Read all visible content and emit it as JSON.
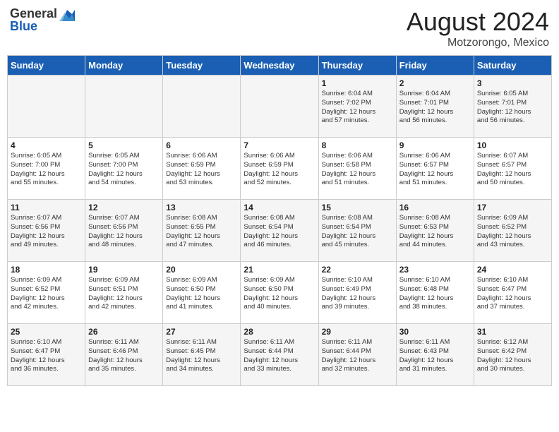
{
  "logo": {
    "general": "General",
    "blue": "Blue"
  },
  "title": "August 2024",
  "subtitle": "Motzorongo, Mexico",
  "days_of_week": [
    "Sunday",
    "Monday",
    "Tuesday",
    "Wednesday",
    "Thursday",
    "Friday",
    "Saturday"
  ],
  "weeks": [
    [
      {
        "day": "",
        "content": ""
      },
      {
        "day": "",
        "content": ""
      },
      {
        "day": "",
        "content": ""
      },
      {
        "day": "",
        "content": ""
      },
      {
        "day": "1",
        "content": "Sunrise: 6:04 AM\nSunset: 7:02 PM\nDaylight: 12 hours\nand 57 minutes."
      },
      {
        "day": "2",
        "content": "Sunrise: 6:04 AM\nSunset: 7:01 PM\nDaylight: 12 hours\nand 56 minutes."
      },
      {
        "day": "3",
        "content": "Sunrise: 6:05 AM\nSunset: 7:01 PM\nDaylight: 12 hours\nand 56 minutes."
      }
    ],
    [
      {
        "day": "4",
        "content": "Sunrise: 6:05 AM\nSunset: 7:00 PM\nDaylight: 12 hours\nand 55 minutes."
      },
      {
        "day": "5",
        "content": "Sunrise: 6:05 AM\nSunset: 7:00 PM\nDaylight: 12 hours\nand 54 minutes."
      },
      {
        "day": "6",
        "content": "Sunrise: 6:06 AM\nSunset: 6:59 PM\nDaylight: 12 hours\nand 53 minutes."
      },
      {
        "day": "7",
        "content": "Sunrise: 6:06 AM\nSunset: 6:59 PM\nDaylight: 12 hours\nand 52 minutes."
      },
      {
        "day": "8",
        "content": "Sunrise: 6:06 AM\nSunset: 6:58 PM\nDaylight: 12 hours\nand 51 minutes."
      },
      {
        "day": "9",
        "content": "Sunrise: 6:06 AM\nSunset: 6:57 PM\nDaylight: 12 hours\nand 51 minutes."
      },
      {
        "day": "10",
        "content": "Sunrise: 6:07 AM\nSunset: 6:57 PM\nDaylight: 12 hours\nand 50 minutes."
      }
    ],
    [
      {
        "day": "11",
        "content": "Sunrise: 6:07 AM\nSunset: 6:56 PM\nDaylight: 12 hours\nand 49 minutes."
      },
      {
        "day": "12",
        "content": "Sunrise: 6:07 AM\nSunset: 6:56 PM\nDaylight: 12 hours\nand 48 minutes."
      },
      {
        "day": "13",
        "content": "Sunrise: 6:08 AM\nSunset: 6:55 PM\nDaylight: 12 hours\nand 47 minutes."
      },
      {
        "day": "14",
        "content": "Sunrise: 6:08 AM\nSunset: 6:54 PM\nDaylight: 12 hours\nand 46 minutes."
      },
      {
        "day": "15",
        "content": "Sunrise: 6:08 AM\nSunset: 6:54 PM\nDaylight: 12 hours\nand 45 minutes."
      },
      {
        "day": "16",
        "content": "Sunrise: 6:08 AM\nSunset: 6:53 PM\nDaylight: 12 hours\nand 44 minutes."
      },
      {
        "day": "17",
        "content": "Sunrise: 6:09 AM\nSunset: 6:52 PM\nDaylight: 12 hours\nand 43 minutes."
      }
    ],
    [
      {
        "day": "18",
        "content": "Sunrise: 6:09 AM\nSunset: 6:52 PM\nDaylight: 12 hours\nand 42 minutes."
      },
      {
        "day": "19",
        "content": "Sunrise: 6:09 AM\nSunset: 6:51 PM\nDaylight: 12 hours\nand 42 minutes."
      },
      {
        "day": "20",
        "content": "Sunrise: 6:09 AM\nSunset: 6:50 PM\nDaylight: 12 hours\nand 41 minutes."
      },
      {
        "day": "21",
        "content": "Sunrise: 6:09 AM\nSunset: 6:50 PM\nDaylight: 12 hours\nand 40 minutes."
      },
      {
        "day": "22",
        "content": "Sunrise: 6:10 AM\nSunset: 6:49 PM\nDaylight: 12 hours\nand 39 minutes."
      },
      {
        "day": "23",
        "content": "Sunrise: 6:10 AM\nSunset: 6:48 PM\nDaylight: 12 hours\nand 38 minutes."
      },
      {
        "day": "24",
        "content": "Sunrise: 6:10 AM\nSunset: 6:47 PM\nDaylight: 12 hours\nand 37 minutes."
      }
    ],
    [
      {
        "day": "25",
        "content": "Sunrise: 6:10 AM\nSunset: 6:47 PM\nDaylight: 12 hours\nand 36 minutes."
      },
      {
        "day": "26",
        "content": "Sunrise: 6:11 AM\nSunset: 6:46 PM\nDaylight: 12 hours\nand 35 minutes."
      },
      {
        "day": "27",
        "content": "Sunrise: 6:11 AM\nSunset: 6:45 PM\nDaylight: 12 hours\nand 34 minutes."
      },
      {
        "day": "28",
        "content": "Sunrise: 6:11 AM\nSunset: 6:44 PM\nDaylight: 12 hours\nand 33 minutes."
      },
      {
        "day": "29",
        "content": "Sunrise: 6:11 AM\nSunset: 6:44 PM\nDaylight: 12 hours\nand 32 minutes."
      },
      {
        "day": "30",
        "content": "Sunrise: 6:11 AM\nSunset: 6:43 PM\nDaylight: 12 hours\nand 31 minutes."
      },
      {
        "day": "31",
        "content": "Sunrise: 6:12 AM\nSunset: 6:42 PM\nDaylight: 12 hours\nand 30 minutes."
      }
    ]
  ]
}
